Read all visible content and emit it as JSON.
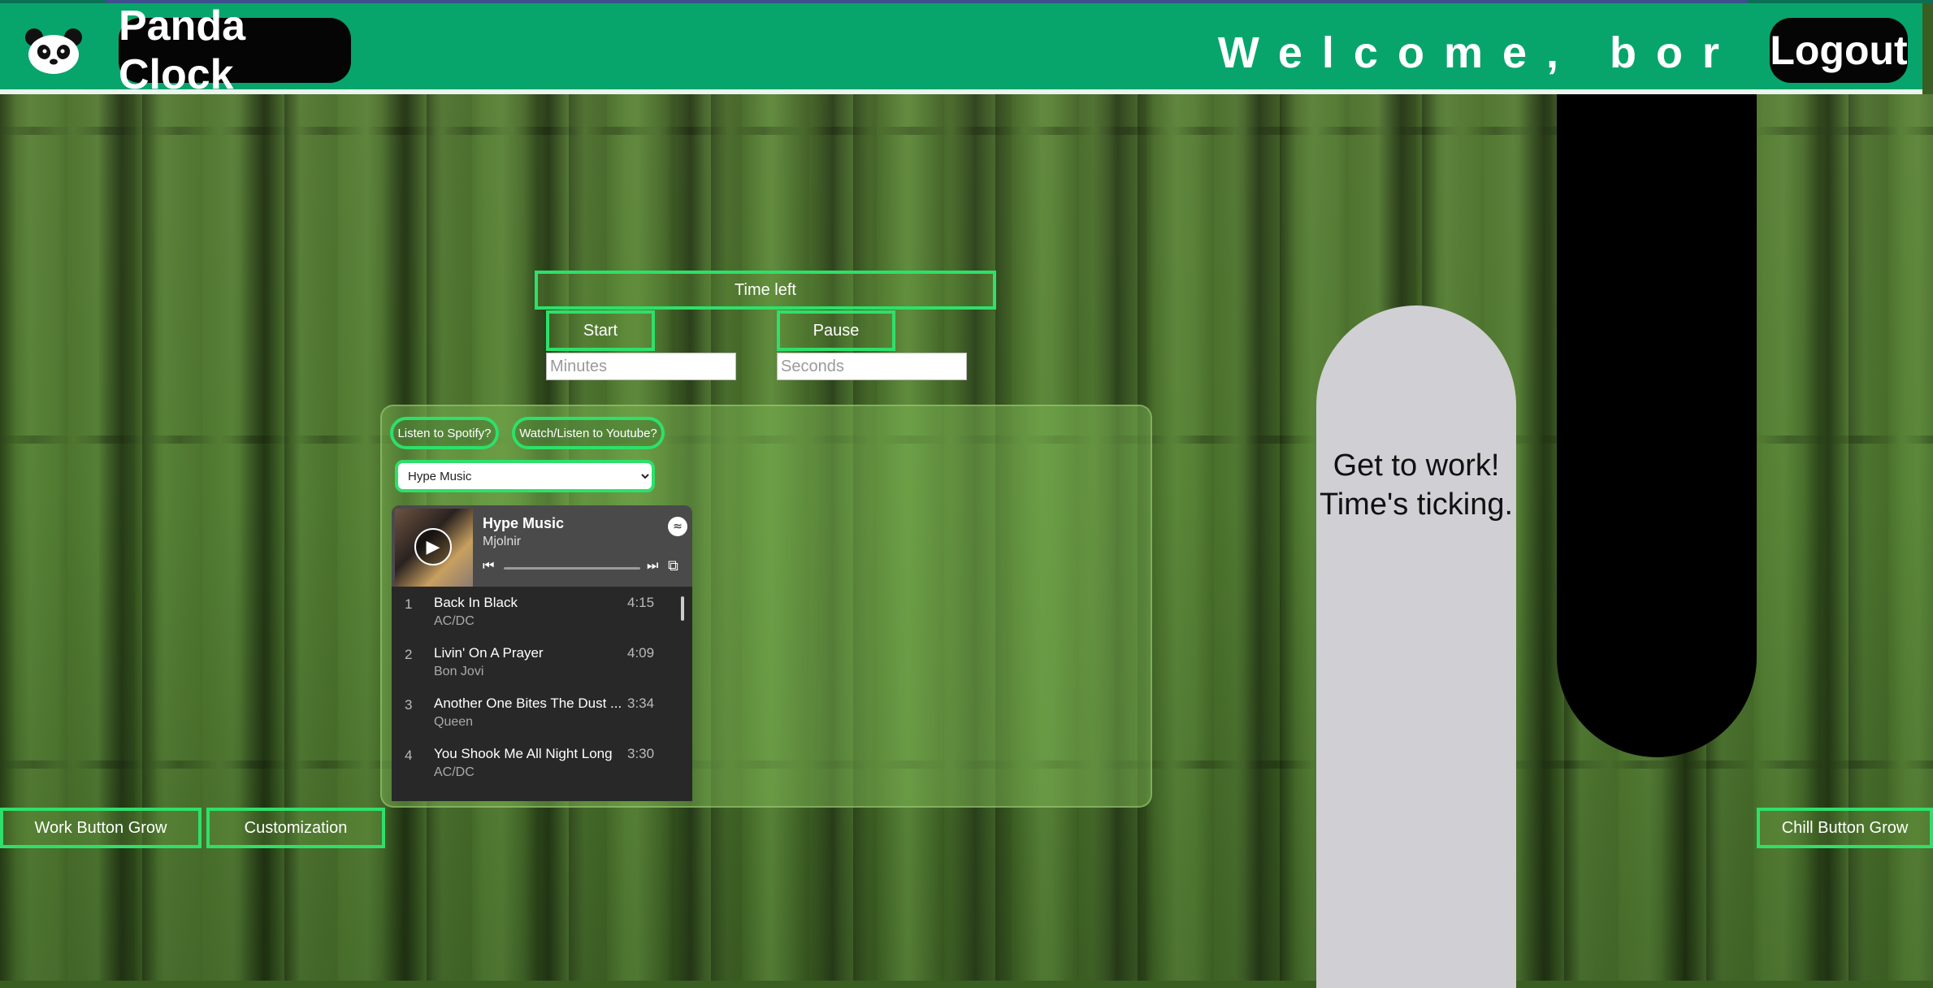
{
  "header": {
    "brand": "Panda Clock",
    "welcome": "Welcome, bor",
    "logout_label": "Logout"
  },
  "timer": {
    "time_left_label": "Time left",
    "start_label": "Start",
    "pause_label": "Pause",
    "minutes_placeholder": "Minutes",
    "seconds_placeholder": "Seconds"
  },
  "music": {
    "spotify_button": "Listen to Spotify?",
    "youtube_button": "Watch/Listen to Youtube?",
    "selected_playlist": "Hype Music",
    "player": {
      "playlist_title": "Hype Music",
      "owner": "Mjolnir",
      "tracks": [
        {
          "num": "1",
          "name": "Back In Black",
          "artist": "AC/DC",
          "duration": "4:15"
        },
        {
          "num": "2",
          "name": "Livin' On A Prayer",
          "artist": "Bon Jovi",
          "duration": "4:09"
        },
        {
          "num": "3",
          "name": "Another One Bites The Dust ...",
          "artist": "Queen",
          "duration": "3:34"
        },
        {
          "num": "4",
          "name": "You Shook Me All Night Long",
          "artist": "AC/DC",
          "duration": "3:30"
        }
      ]
    }
  },
  "footer": {
    "work_button": "Work Button Grow",
    "customization_button": "Customization",
    "chill_button": "Chill Button Grow"
  },
  "motivation_text": "Get to work! Time's ticking.",
  "colors": {
    "header_green": "#07a56c",
    "accent_green": "#2ee06a",
    "capsule_gray": "#d0cfd3",
    "capsule_black": "#000000"
  },
  "icons": [
    "panda-logo-icon",
    "play-icon",
    "spotify-icon",
    "skip-previous-icon",
    "skip-next-icon",
    "share-icon"
  ]
}
